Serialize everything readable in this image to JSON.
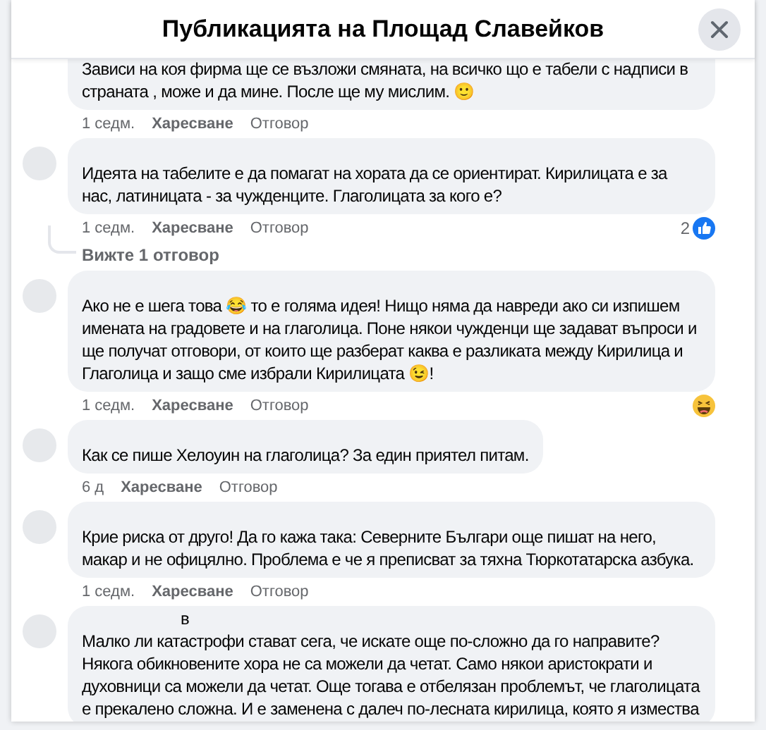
{
  "dialog": {
    "title": "Публикацията на Площад Славейков"
  },
  "comments": [
    {
      "text": "Зависи на коя фирма ще се възложи смяната, на всичко що е табели с надписи в страната , може и да мине. После ще му мислим. 🙂",
      "time": "1 седм.",
      "like": "Харесване",
      "reply": "Отговор",
      "cut_top": true
    },
    {
      "text": "Идеята на табелите е да помагат на хората да се ориентират. Кирилицата е за нас, латиницата - за чужденците. Глаголицата за кого е?",
      "time": "1 седм.",
      "like": "Харесване",
      "reply": "Отговор",
      "reaction": {
        "kind": "like",
        "count": "2"
      },
      "replies_link": "Вижте 1 отговор"
    },
    {
      "text": "Ако не е шега това 😂 то е голяма идея! Нищо няма да навреди ако си изпишем имената на градовете и на глаголица. Поне някои чужденци ще задават въпроси и ще получат отговори, от които ще разберат каква е разликата между Кирилица и Глаголица и защо сме избрали Кирилицата 😉!",
      "time": "1 седм.",
      "like": "Харесване",
      "reply": "Отговор",
      "reaction": {
        "kind": "laugh"
      }
    },
    {
      "text": "Как се пише Хелоуин на глаголица? За един приятел питам.",
      "time": "6 д",
      "like": "Харесване",
      "reply": "Отговор"
    },
    {
      "text": "Крие риска от друго! Да го кажа така: Северните Българи още пишат на него, макар и не офицялно. Проблема е че я преписват за тяхна Тюркотатарска азбука.",
      "time": "1 седм.",
      "like": "Харесване",
      "reply": "Отговор"
    },
    {
      "author": "в",
      "text": "Малко ли катастрофи стават сега, че искате още по-сложно да го направите? Някога обикновените хора не са можели да четат. Само някои аристократи и духовници са можели да четат. Още тогава е отбелязан проблемът, че глаголицата е прекалено сложна. И е заменена с далеч по-лесната кирилица, която я измества"
    }
  ]
}
